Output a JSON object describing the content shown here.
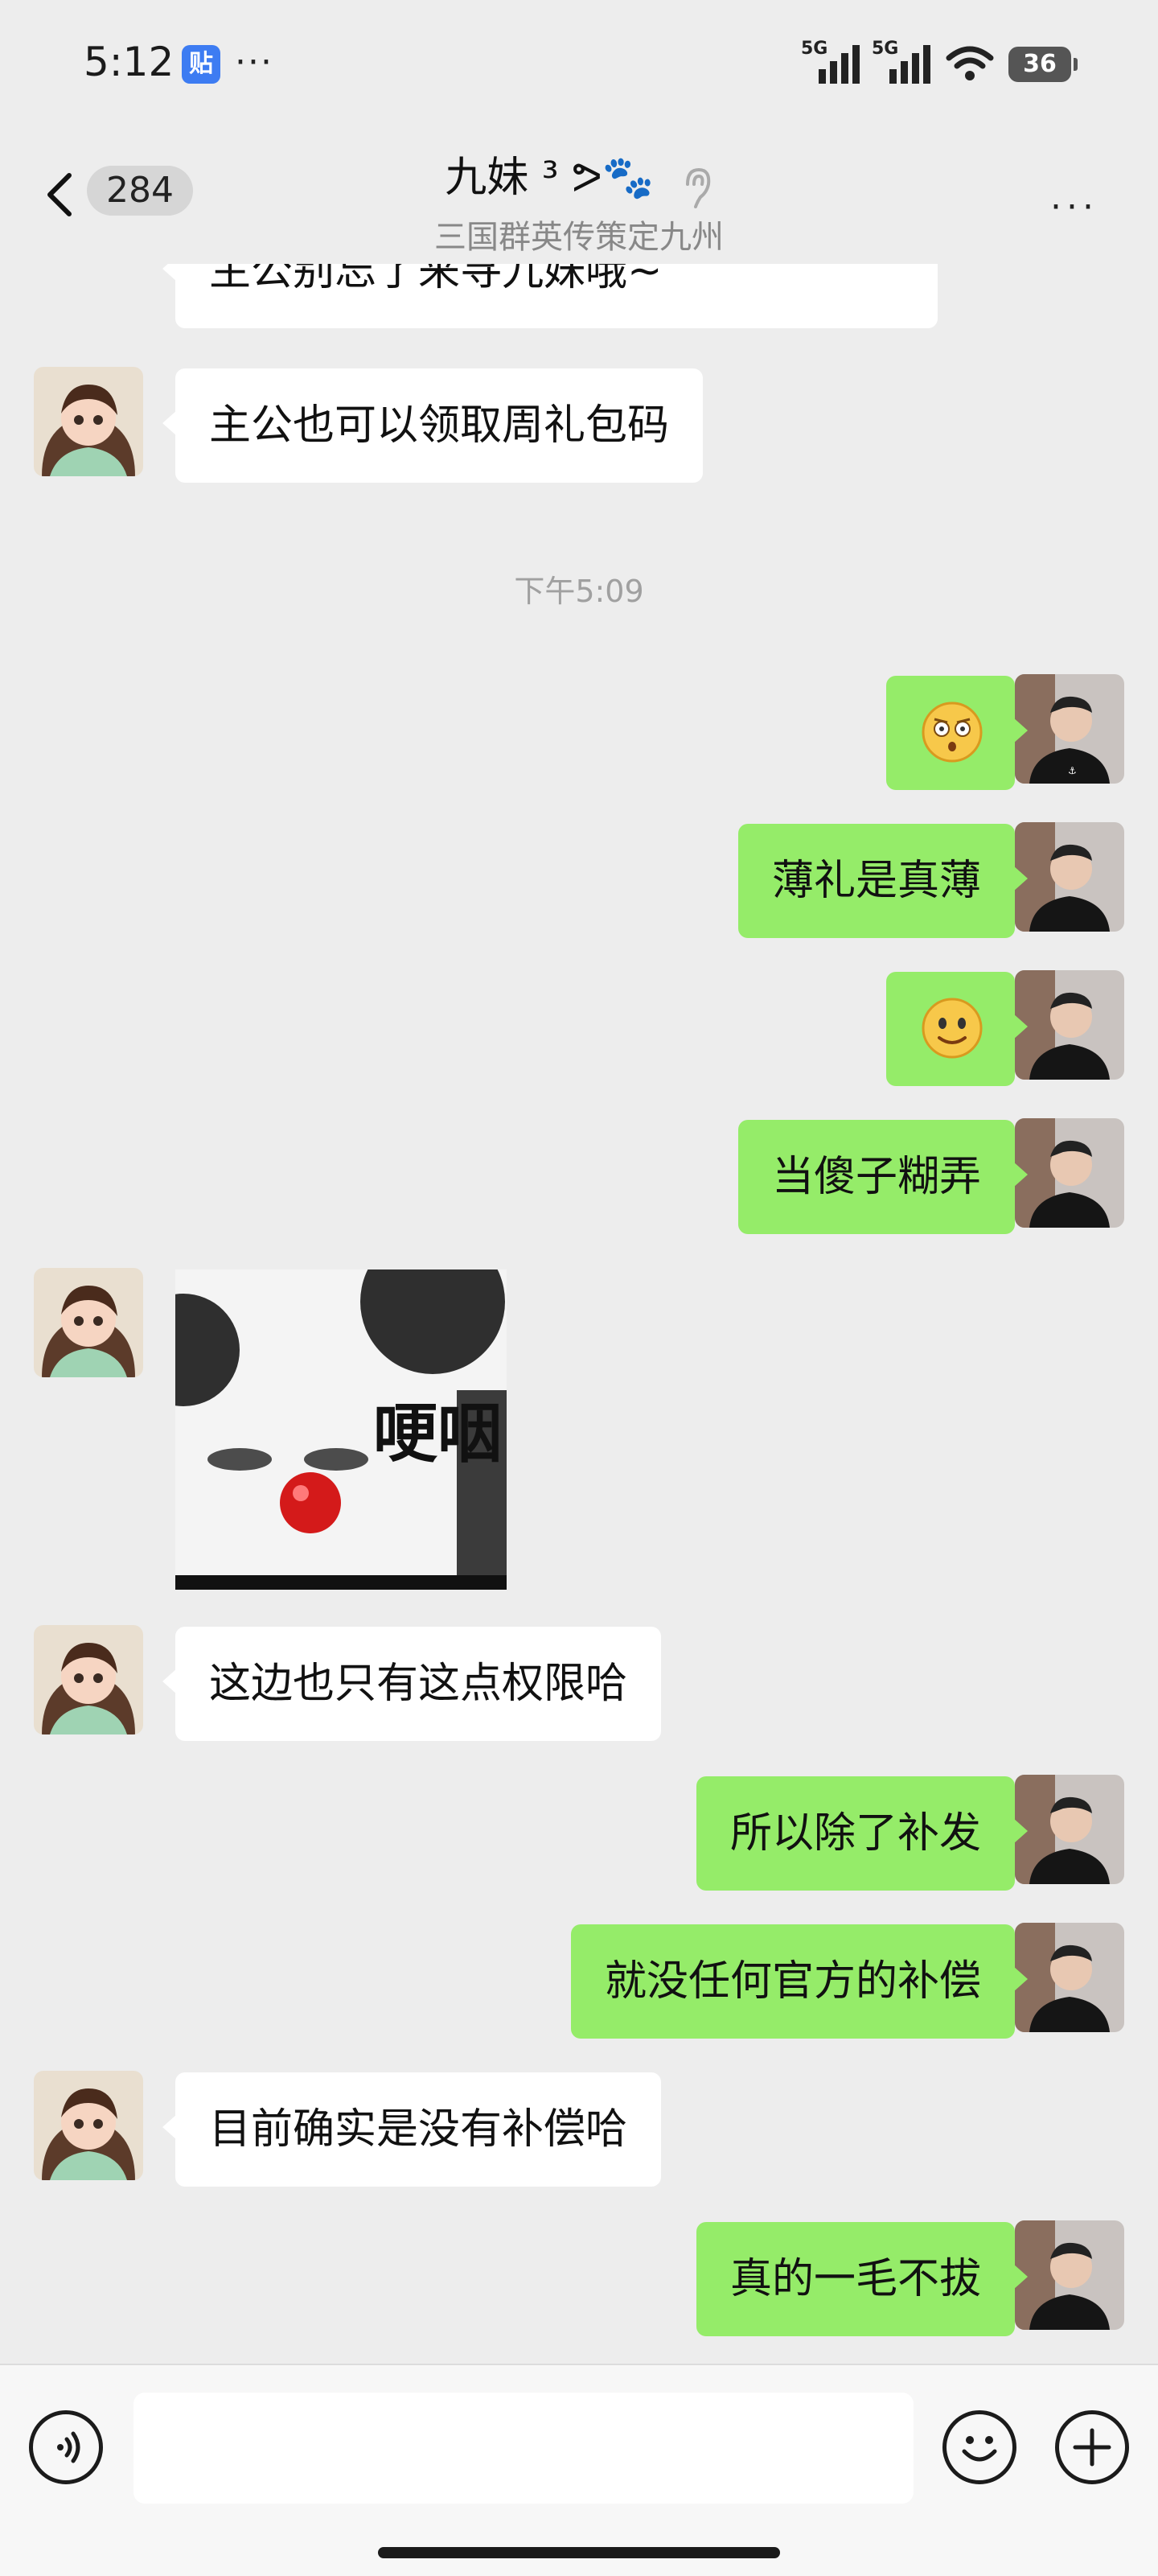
{
  "status_bar": {
    "time": "5:12",
    "app_badge": "贴",
    "more": "···",
    "signal1": "5G",
    "signal2": "5G",
    "battery": "36"
  },
  "header": {
    "unread_count": "284",
    "title": "九妹 ³ ᕗ🐾",
    "subtitle": "三国群英传策定九州",
    "more": "···"
  },
  "chat": {
    "timestamp": "下午5:09",
    "messages": [
      {
        "side": "left",
        "text": "主公别忘了来寻九妹哦~"
      },
      {
        "side": "left",
        "text": "主公也可以领取周礼包码"
      },
      {
        "side": "right",
        "emoji": "shocked-face-emoji"
      },
      {
        "side": "right",
        "text": "薄礼是真薄"
      },
      {
        "side": "right",
        "emoji": "smiling-face-emoji"
      },
      {
        "side": "right",
        "text": "当傻子糊弄"
      },
      {
        "side": "left",
        "sticker_text": "哽咽"
      },
      {
        "side": "left",
        "text": "这边也只有这点权限哈"
      },
      {
        "side": "right",
        "text": "所以除了补发"
      },
      {
        "side": "right",
        "text": "就没任何官方的补偿"
      },
      {
        "side": "left",
        "text": "目前确实是没有补偿哈"
      },
      {
        "side": "right",
        "text": "真的一毛不拔"
      }
    ]
  },
  "colors": {
    "background": "#ededed",
    "self_bubble": "#95ec69",
    "other_bubble": "#ffffff"
  }
}
